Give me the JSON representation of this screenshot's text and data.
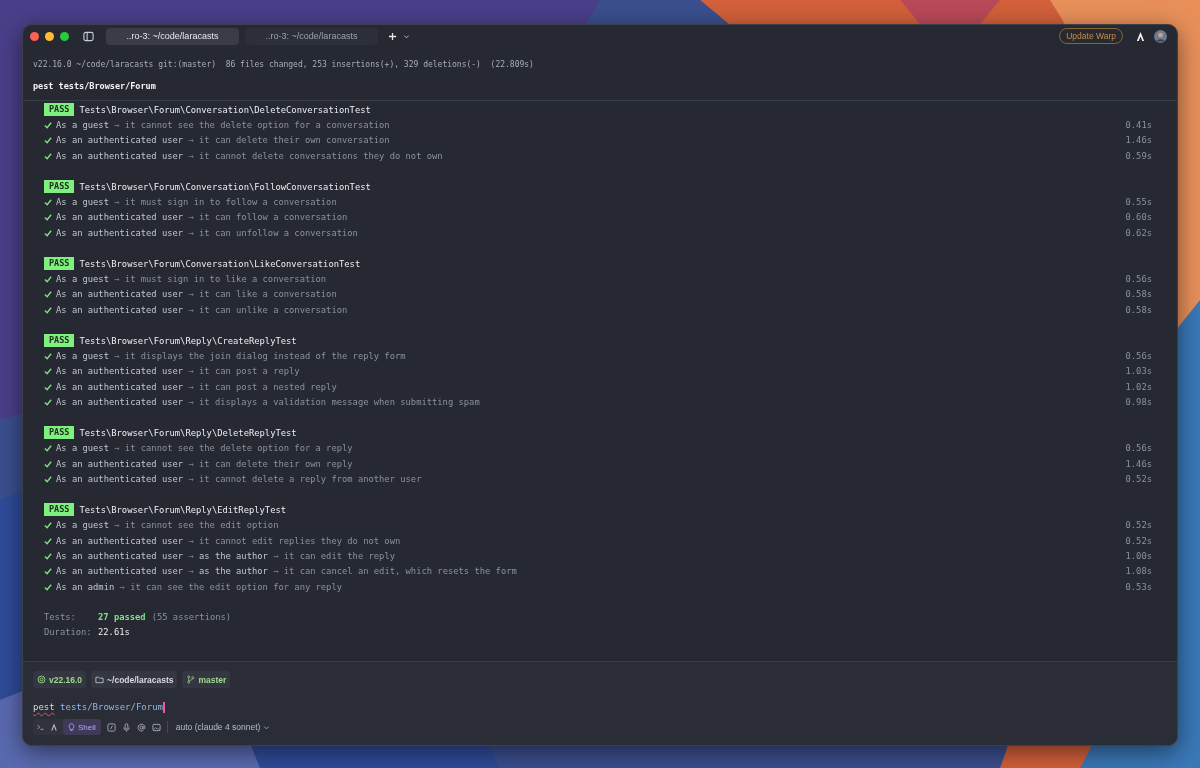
{
  "title_bar": {
    "tabs": [
      {
        "label": "..ro-3: ~/code/laracasts",
        "selected": true
      },
      {
        "label": "..ro-3: ~/code/laracasts",
        "selected": false
      }
    ],
    "update_button": "Update Warp"
  },
  "block_header": {
    "info": "v22.16.0 ~/code/laracasts git:(master)  86 files changed, 253 insertions(+), 329 deletions(-)  (22.809s)",
    "command": "pest tests/Browser/Forum"
  },
  "groups": [
    {
      "status": "PASS",
      "name": "Tests\\Browser\\Forum\\Conversation\\DeleteConversationTest",
      "tests": [
        {
          "segments": [
            "As a guest",
            "→",
            "it cannot see the delete option for a conversation"
          ],
          "time": "0.41s"
        },
        {
          "segments": [
            "As an authenticated user",
            "→",
            "it can delete their own conversation"
          ],
          "time": "1.46s"
        },
        {
          "segments": [
            "As an authenticated user",
            "→",
            "it cannot delete conversations they do not own"
          ],
          "time": "0.59s"
        }
      ]
    },
    {
      "status": "PASS",
      "name": "Tests\\Browser\\Forum\\Conversation\\FollowConversationTest",
      "tests": [
        {
          "segments": [
            "As a guest",
            "→",
            "it must sign in to follow a conversation"
          ],
          "time": "0.55s"
        },
        {
          "segments": [
            "As an authenticated user",
            "→",
            "it can follow a conversation"
          ],
          "time": "0.60s"
        },
        {
          "segments": [
            "As an authenticated user",
            "→",
            "it can unfollow a conversation"
          ],
          "time": "0.62s"
        }
      ]
    },
    {
      "status": "PASS",
      "name": "Tests\\Browser\\Forum\\Conversation\\LikeConversationTest",
      "tests": [
        {
          "segments": [
            "As a guest",
            "→",
            "it must sign in to like a conversation"
          ],
          "time": "0.56s"
        },
        {
          "segments": [
            "As an authenticated user",
            "→",
            "it can like a conversation"
          ],
          "time": "0.58s"
        },
        {
          "segments": [
            "As an authenticated user",
            "→",
            "it can unlike a conversation"
          ],
          "time": "0.58s"
        }
      ]
    },
    {
      "status": "PASS",
      "name": "Tests\\Browser\\Forum\\Reply\\CreateReplyTest",
      "tests": [
        {
          "segments": [
            "As a guest",
            "→",
            "it displays the join dialog instead of the reply form"
          ],
          "time": "0.56s"
        },
        {
          "segments": [
            "As an authenticated user",
            "→",
            "it can post a reply"
          ],
          "time": "1.03s"
        },
        {
          "segments": [
            "As an authenticated user",
            "→",
            "it can post a nested reply"
          ],
          "time": "1.02s"
        },
        {
          "segments": [
            "As an authenticated user",
            "→",
            "it displays a validation message when submitting spam"
          ],
          "time": "0.98s"
        }
      ]
    },
    {
      "status": "PASS",
      "name": "Tests\\Browser\\Forum\\Reply\\DeleteReplyTest",
      "tests": [
        {
          "segments": [
            "As a guest",
            "→",
            "it cannot see the delete option for a reply"
          ],
          "time": "0.56s"
        },
        {
          "segments": [
            "As an authenticated user",
            "→",
            "it can delete their own reply"
          ],
          "time": "1.46s"
        },
        {
          "segments": [
            "As an authenticated user",
            "→",
            "it cannot delete a reply from another user"
          ],
          "time": "0.52s"
        }
      ]
    },
    {
      "status": "PASS",
      "name": "Tests\\Browser\\Forum\\Reply\\EditReplyTest",
      "tests": [
        {
          "segments": [
            "As a guest",
            "→",
            "it cannot see the edit option"
          ],
          "time": "0.52s"
        },
        {
          "segments": [
            "As an authenticated user",
            "→",
            "it cannot edit replies they do not own"
          ],
          "time": "0.52s"
        },
        {
          "segments": [
            "As an authenticated user",
            "→",
            "as the author",
            "→",
            "it can edit the reply"
          ],
          "time": "1.00s"
        },
        {
          "segments": [
            "As an authenticated user",
            "→",
            "as the author",
            "→",
            "it can cancel an edit, which resets the form"
          ],
          "time": "1.08s"
        },
        {
          "segments": [
            "As an admin",
            "→",
            "it can see the edit option for any reply"
          ],
          "time": "0.53s"
        }
      ]
    }
  ],
  "summary": {
    "tests_label": "Tests:",
    "passed": "27 passed",
    "assertions": "(55 assertions)",
    "duration_label": "Duration:",
    "duration": "22.61s"
  },
  "prompt": {
    "chips": [
      {
        "kind": "node",
        "label": "v22.16.0"
      },
      {
        "kind": "folder",
        "label": "~/code/laracasts"
      },
      {
        "kind": "branch",
        "label": "master"
      }
    ],
    "command": "pest",
    "command_flagged": true,
    "args": "tests/Browser/Forum",
    "mode": "Shell",
    "model": "auto (claude 4 sonnet)"
  }
}
